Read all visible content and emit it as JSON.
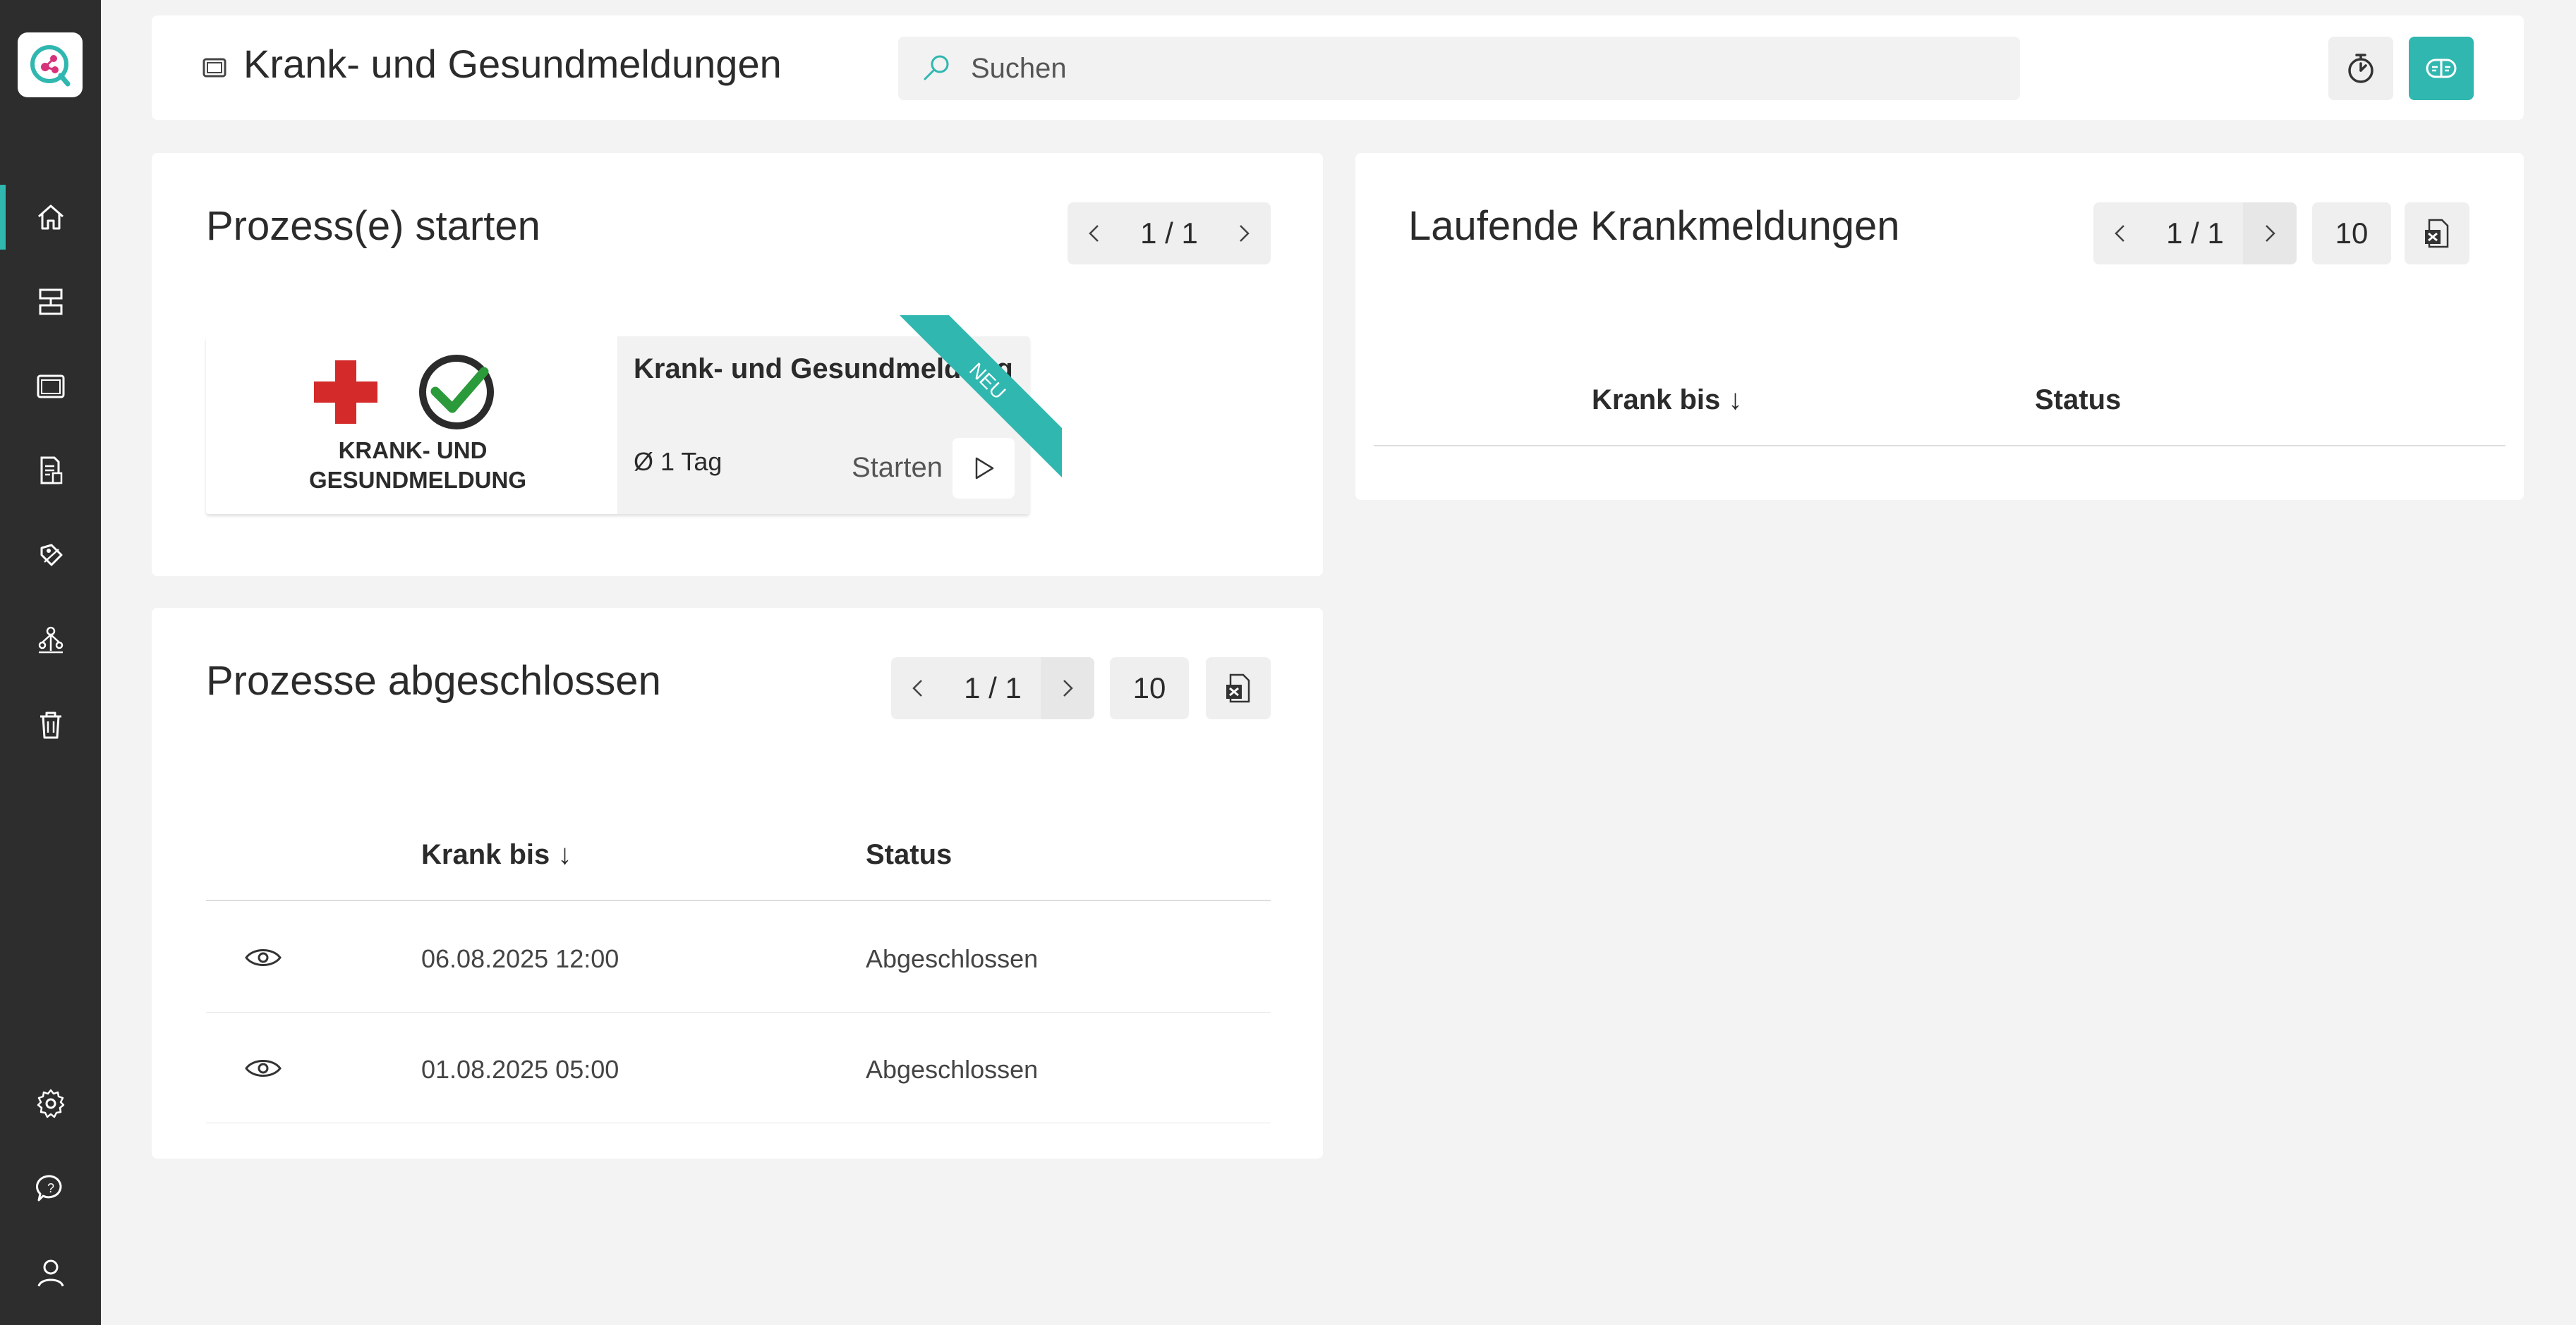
{
  "header": {
    "title": "Krank- und Gesundmeldungen",
    "search_placeholder": "Suchen"
  },
  "colors": {
    "accent": "#2fb7b0",
    "sidebar": "#2d2d2d",
    "background": "#f3f3f3"
  },
  "sidebar": {
    "items": [
      {
        "icon": "home-icon",
        "active": true
      },
      {
        "icon": "process-icon"
      },
      {
        "icon": "window-icon"
      },
      {
        "icon": "document-icon"
      },
      {
        "icon": "tag-icon"
      },
      {
        "icon": "org-chart-icon"
      },
      {
        "icon": "trash-icon"
      },
      {
        "icon": "settings-icon"
      },
      {
        "icon": "help-chat-icon"
      },
      {
        "icon": "user-icon"
      }
    ]
  },
  "start_card": {
    "title": "Prozess(e) starten",
    "pager": "1 / 1",
    "process": {
      "name": "Krank- und Gesundmeldung",
      "duration": "Ø 1 Tag",
      "start_label": "Starten",
      "badge": "NEU",
      "image_text_line1": "KRANK- UND",
      "image_text_line2": "GESUNDMELDUNG"
    }
  },
  "running_card": {
    "title": "Laufende Krankmeldungen",
    "pager": "1 / 1",
    "page_size": "10",
    "columns": [
      "Krank bis ↓",
      "Status"
    ]
  },
  "finished_card": {
    "title": "Prozesse abgeschlossen",
    "pager": "1 / 1",
    "page_size": "10",
    "columns": [
      "Krank bis ↓",
      "Status"
    ],
    "rows": [
      {
        "date": "06.08.2025 12:00",
        "status": "Abgeschlossen"
      },
      {
        "date": "01.08.2025 05:00",
        "status": "Abgeschlossen"
      }
    ]
  }
}
